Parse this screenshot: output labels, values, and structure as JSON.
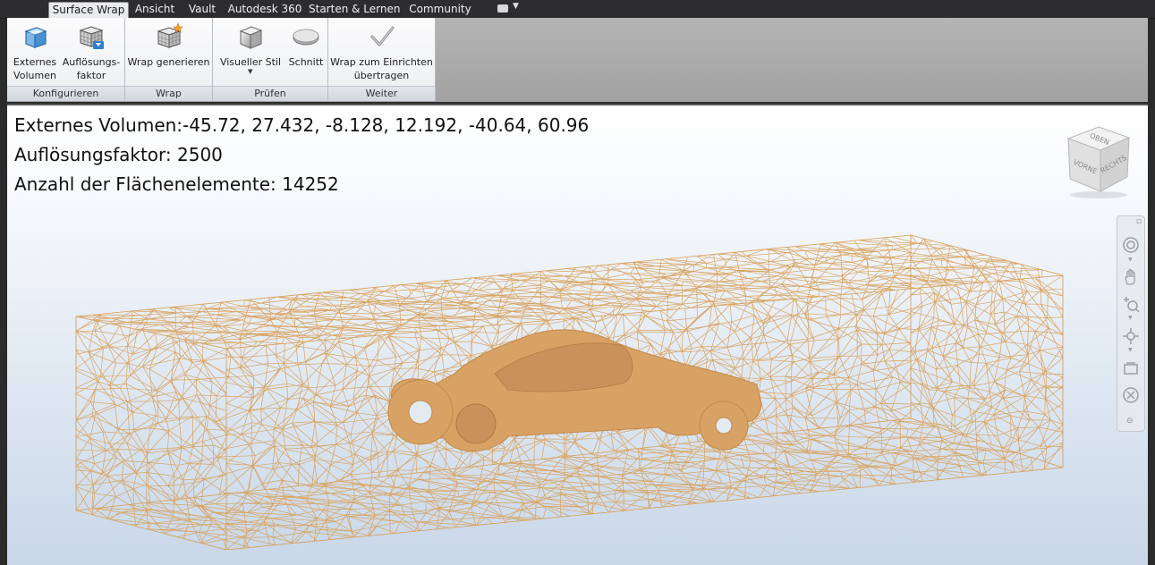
{
  "tabs": [
    {
      "label": "Surface Wrap",
      "active": true
    },
    {
      "label": "Ansicht",
      "active": false
    },
    {
      "label": "Vault",
      "active": false
    },
    {
      "label": "Autodesk 360",
      "active": false
    },
    {
      "label": "Starten & Lernen",
      "active": false
    },
    {
      "label": "Community",
      "active": false
    }
  ],
  "ribbon": {
    "panels": {
      "konfigurieren": {
        "title": "Konfigurieren",
        "externes_volumen": {
          "line1": "Externes",
          "line2": "Volumen"
        },
        "aufloesungsfaktor": {
          "line1": "Auflösungs-",
          "line2": "faktor"
        }
      },
      "wrap": {
        "title": "Wrap",
        "wrap_generieren": {
          "label": "Wrap generieren"
        }
      },
      "pruefen": {
        "title": "Prüfen",
        "visueller_stil": {
          "label": "Visueller Stil"
        },
        "schnitt": {
          "label": "Schnitt"
        }
      },
      "weiter": {
        "title": "Weiter",
        "wrap_uebertragen": {
          "line1": "Wrap zum Einrichten",
          "line2": "übertragen"
        }
      }
    }
  },
  "viewport": {
    "info": {
      "externes_volumen": "Externes Volumen:-45.72, 27.432, -8.128, 12.192, -40.64, 60.96",
      "aufloesungsfaktor": "Auflösungsfaktor: 2500",
      "flaechenelemente": "Anzahl der Flächenelemente: 14252"
    },
    "viewcube": {
      "top": "OBEN",
      "front": "VORNE",
      "right": "RECHTS"
    }
  },
  "colors": {
    "mesh": "#d9a35f",
    "model": "#d9a265",
    "tabbar": "#2d2d30"
  }
}
